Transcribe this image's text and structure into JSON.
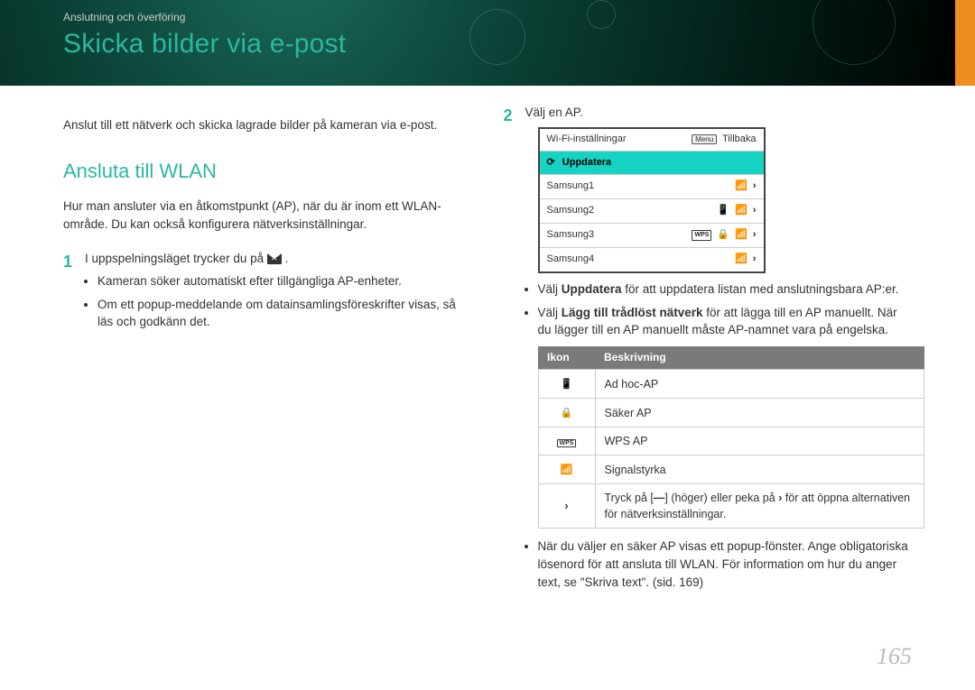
{
  "header": {
    "breadcrumb": "Anslutning och överföring",
    "title": "Skicka bilder via e-post"
  },
  "left": {
    "intro": "Anslut till ett nätverk och skicka lagrade bilder på kameran via e-post.",
    "section_title": "Ansluta till WLAN",
    "section_desc": "Hur man ansluter via en åtkomstpunkt (AP), när du är inom ett WLAN-område. Du kan också konfigurera nätverksinställningar.",
    "step1_num": "1",
    "step1_text_a": "I uppspelningsläget trycker du på ",
    "step1_text_b": ".",
    "step1_bullets": [
      "Kameran söker automatiskt efter tillgängliga AP-enheter.",
      "Om ett popup-meddelande om datainsamlingsföreskrifter visas, så läs och godkänn det."
    ]
  },
  "right": {
    "step2_num": "2",
    "step2_text": "Välj en AP.",
    "wifi": {
      "title": "Wi-Fi-inställningar",
      "menu_label": "Menu",
      "back_label": "Tillbaka",
      "update_label": "Uppdatera",
      "rows": [
        {
          "name": "Samsung1",
          "icons": [
            "wifi",
            "chev"
          ]
        },
        {
          "name": "Samsung2",
          "icons": [
            "phone",
            "wifi",
            "chev"
          ]
        },
        {
          "name": "Samsung3",
          "icons": [
            "wps",
            "lock",
            "wifi",
            "chev"
          ]
        },
        {
          "name": "Samsung4",
          "icons": [
            "wifi",
            "chev"
          ]
        }
      ]
    },
    "bullets_after_panel": [
      {
        "pre": "Välj ",
        "bold": "Uppdatera",
        "post": " för att uppdatera listan med anslutningsbara AP:er."
      },
      {
        "pre": "Välj ",
        "bold": "Lägg till trådlöst nätverk",
        "post": " för att lägga till en AP manuellt. När du lägger till en AP manuellt måste AP-namnet vara på engelska."
      }
    ],
    "table": {
      "head_icon": "Ikon",
      "head_desc": "Beskrivning",
      "rows": [
        {
          "icon": "phone",
          "desc": "Ad hoc-AP"
        },
        {
          "icon": "lock",
          "desc": "Säker AP"
        },
        {
          "icon": "wps",
          "desc": "WPS AP"
        },
        {
          "icon": "wifi",
          "desc": "Signalstyrka"
        },
        {
          "icon": "chev",
          "desc_pre": "Tryck på [",
          "desc_mid": "] (höger) eller peka på ",
          "desc_post": " för att öppna alternativen för nätverksinställningar."
        }
      ]
    },
    "final_bullet": "När du väljer en säker AP visas ett popup-fönster. Ange obligatoriska lösenord för att ansluta till WLAN. För information om hur du anger text, se \"Skriva text\". (sid. 169)"
  },
  "page_number": "165"
}
